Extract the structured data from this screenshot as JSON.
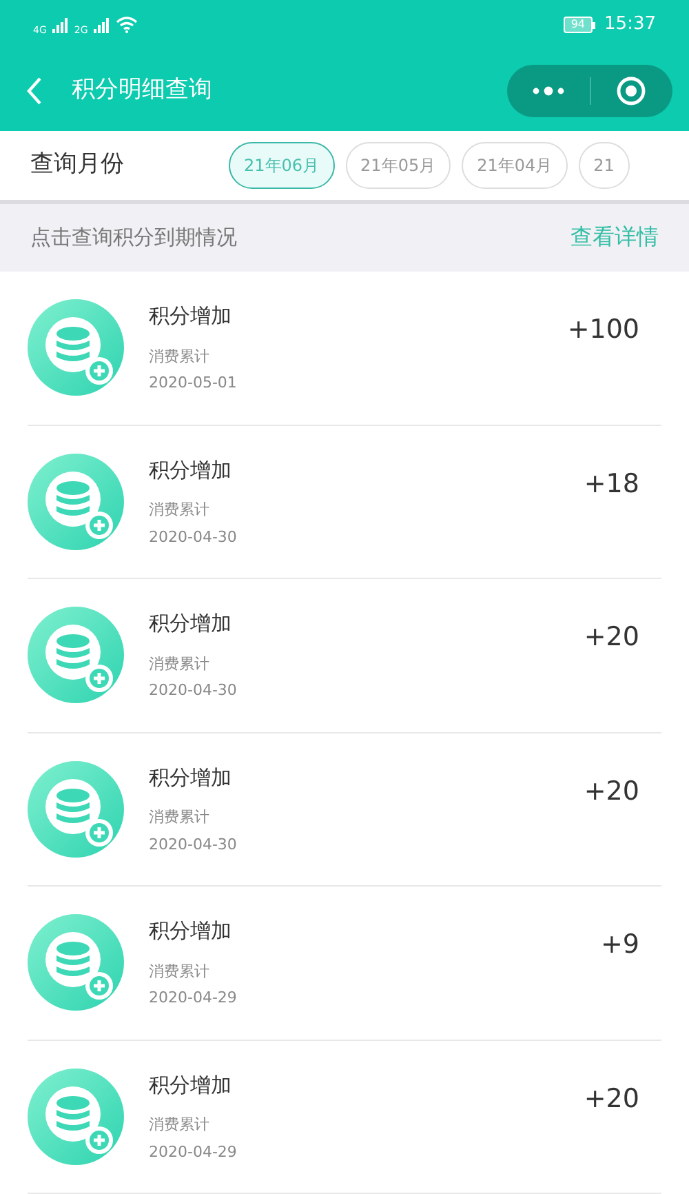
{
  "status_bar": {
    "network_1": "4G",
    "network_2": "2G",
    "battery": "94",
    "time": "15:37"
  },
  "header": {
    "title": "积分明细查询"
  },
  "month_filter": {
    "label": "查询月份",
    "months": [
      {
        "label": "21年06月",
        "selected": true
      },
      {
        "label": "21年05月",
        "selected": false
      },
      {
        "label": "21年04月",
        "selected": false
      },
      {
        "label": "21",
        "selected": false
      }
    ]
  },
  "expiry_banner": {
    "text": "点击查询积分到期情况",
    "link": "查看详情"
  },
  "records": [
    {
      "title": "积分增加",
      "source": "消费累计",
      "date": "2020-05-01",
      "points": "+100"
    },
    {
      "title": "积分增加",
      "source": "消费累计",
      "date": "2020-04-30",
      "points": "+18"
    },
    {
      "title": "积分增加",
      "source": "消费累计",
      "date": "2020-04-30",
      "points": "+20"
    },
    {
      "title": "积分增加",
      "source": "消费累计",
      "date": "2020-04-30",
      "points": "+20"
    },
    {
      "title": "积分增加",
      "source": "消费累计",
      "date": "2020-04-29",
      "points": "+9"
    },
    {
      "title": "积分增加",
      "source": "消费累计",
      "date": "2020-04-29",
      "points": "+20"
    }
  ]
}
